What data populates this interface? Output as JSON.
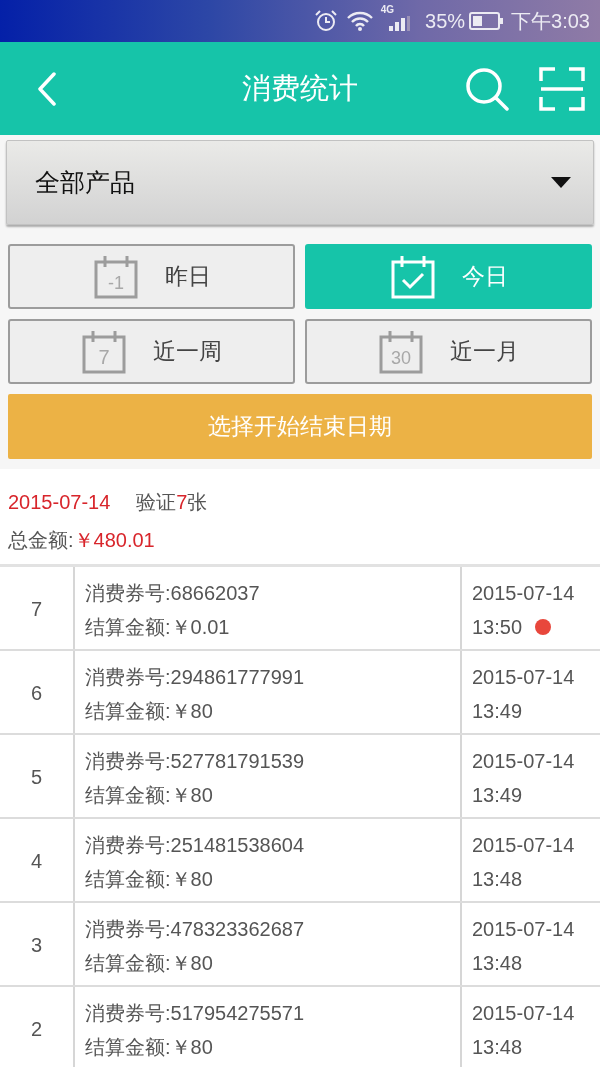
{
  "status_bar": {
    "network": "4G",
    "battery": "35%",
    "time": "下午3:03"
  },
  "app_bar": {
    "title": "消费统计"
  },
  "product_filter": {
    "value": "全部产品"
  },
  "date_ranges": [
    {
      "kind": "number",
      "icon_text": "-1",
      "label": "昨日",
      "selected": false
    },
    {
      "kind": "check",
      "label": "今日",
      "selected": true
    },
    {
      "kind": "number",
      "icon_text": "7",
      "label": "近一周",
      "selected": false
    },
    {
      "kind": "number",
      "icon_text": "30",
      "label": "近一月",
      "selected": false
    }
  ],
  "custom_range_button": {
    "label": "选择开始结束日期"
  },
  "summary": {
    "date": "2015-07-14",
    "verified_prefix": "验证",
    "verified_count": "7",
    "verified_suffix": "张",
    "total_label": "总金额:",
    "total_amount": "￥480.01"
  },
  "records": [
    {
      "index": "7",
      "voucher": "消费券号:68662037",
      "amount": "结算金额:￥0.01",
      "date": "2015-07-14",
      "time": "13:50",
      "new": true
    },
    {
      "index": "6",
      "voucher": "消费券号:294861777991",
      "amount": "结算金额:￥80",
      "date": "2015-07-14",
      "time": "13:49",
      "new": false
    },
    {
      "index": "5",
      "voucher": "消费券号:527781791539",
      "amount": "结算金额:￥80",
      "date": "2015-07-14",
      "time": "13:49",
      "new": false
    },
    {
      "index": "4",
      "voucher": "消费券号:251481538604",
      "amount": "结算金额:￥80",
      "date": "2015-07-14",
      "time": "13:48",
      "new": false
    },
    {
      "index": "3",
      "voucher": "消费券号:478323362687",
      "amount": "结算金额:￥80",
      "date": "2015-07-14",
      "time": "13:48",
      "new": false
    },
    {
      "index": "2",
      "voucher": "消费券号:517954275571",
      "amount": "结算金额:￥80",
      "date": "2015-07-14",
      "time": "13:48",
      "new": false
    }
  ]
}
